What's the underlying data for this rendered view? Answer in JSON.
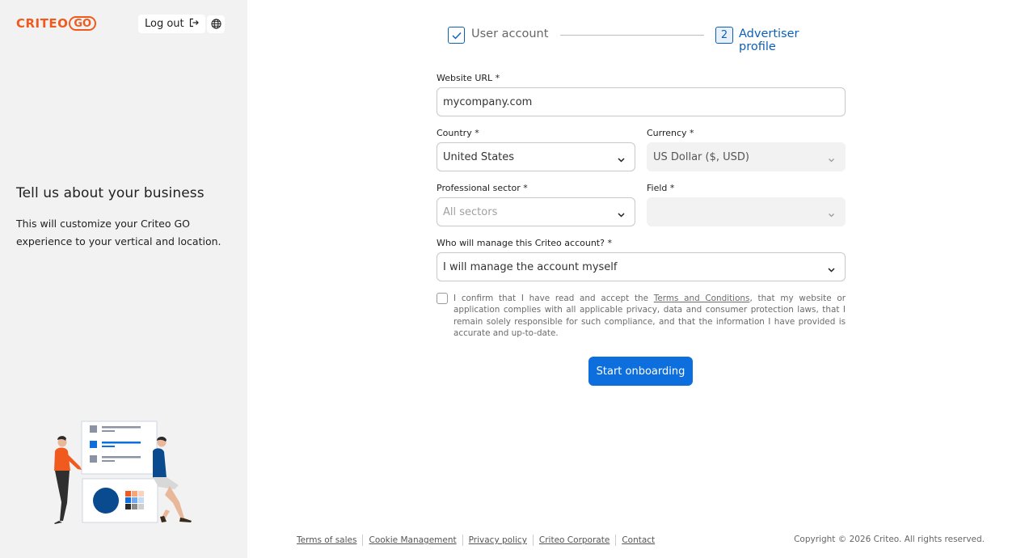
{
  "brand": {
    "name": "CRITEO",
    "suffix": "GO",
    "accent": "#f05a1e",
    "primary": "#0d6ede"
  },
  "header": {
    "logout_label": "Log out",
    "logout_icon": "logout-icon",
    "language_icon": "globe-icon"
  },
  "intro": {
    "title": "Tell us about your business",
    "description": "This will customize your Criteo GO experience to your vertical and location."
  },
  "stepper": {
    "steps": [
      {
        "number": "1",
        "label": "User account",
        "state": "completed"
      },
      {
        "number": "2",
        "label": "Advertiser profile",
        "state": "active"
      }
    ]
  },
  "form": {
    "website": {
      "label": "Website URL *",
      "value": "mycompany.com"
    },
    "country": {
      "label": "Country *",
      "value": "United States"
    },
    "currency": {
      "label": "Currency *",
      "value": "US Dollar ($, USD)"
    },
    "sector": {
      "label": "Professional sector *",
      "placeholder": "All sectors"
    },
    "field": {
      "label": "Field *",
      "value": ""
    },
    "manager": {
      "label": "Who will manage this Criteo account? *",
      "value": "I will manage the account myself"
    },
    "consent": {
      "before": "I confirm that I have read and accept the ",
      "link": "Terms and Conditions",
      "after": ", that my website or application complies with all applicable privacy, data and consumer protection laws, that I remain solely responsible for such compliance, and that the information I have provided is accurate and up-to-date.",
      "checked": false
    },
    "submit_label": "Start onboarding"
  },
  "footer": {
    "links": [
      "Terms of sales",
      "Cookie Management",
      "Privacy policy",
      "Criteo Corporate",
      "Contact"
    ],
    "copyright": "Copyright © 2026 Criteo. All rights reserved."
  }
}
